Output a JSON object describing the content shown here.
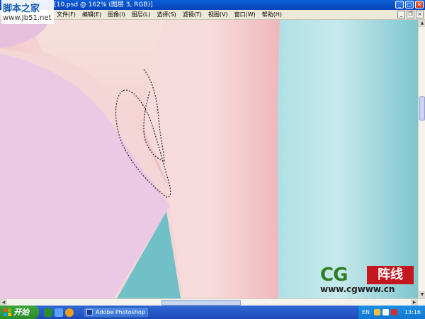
{
  "window": {
    "title": "- [10.psd @ 162% (图层 3, RGB)]",
    "controls": {
      "minimize": "_",
      "maximize": "□",
      "close": "×"
    }
  },
  "watermark": {
    "line1": "脚本之家",
    "line2": "www.Jb51.net"
  },
  "menubar": {
    "items": [
      "文件(F)",
      "编辑(E)",
      "图像(I)",
      "图层(L)",
      "选择(S)",
      "滤镜(T)",
      "视图(V)",
      "窗口(W)",
      "帮助(H)"
    ],
    "doc_controls": {
      "minimize": "_",
      "restore": "❐",
      "close": "×"
    }
  },
  "scrollbars": {
    "up": "▲",
    "down": "▼",
    "left": "◀",
    "right": "▶"
  },
  "logo": {
    "cg": "CG",
    "zx": "阵线",
    "url": "www.cgwww.cn"
  },
  "taskbar": {
    "start_label": "开始",
    "task_button": "Adobe Photoshop ...",
    "tray_lang": "EN",
    "clock": "13:16"
  },
  "colors": {
    "canvas_pink": "#f3d6d6",
    "lilac": "#ebc9e4",
    "teal": "#8ccfd8",
    "taskbar_blue": "#2a5fcc",
    "start_green": "#34a034"
  }
}
